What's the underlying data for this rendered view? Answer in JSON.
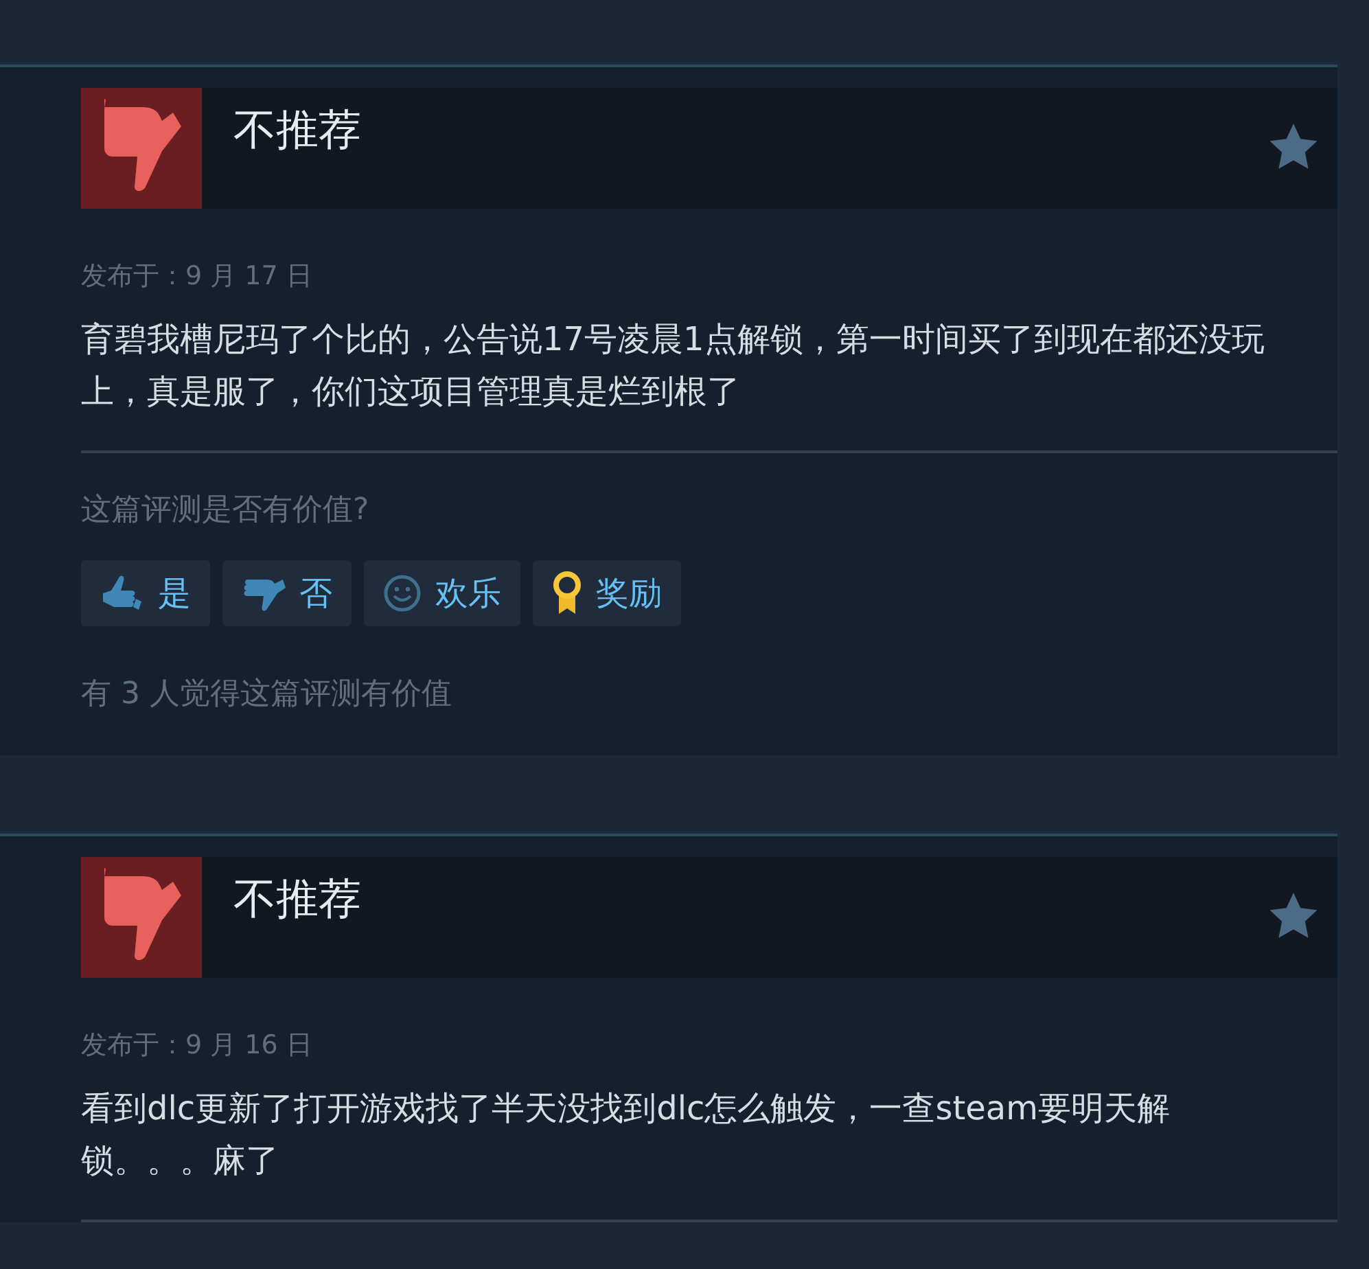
{
  "reviews": [
    {
      "verdict": "不推荐",
      "kind": "not_recommended",
      "posted": "发布于：9 月 17 日",
      "text": "育碧我槽尼玛了个比的，公告说17号凌晨1点解锁，第一时间买了到现在都还没玩上，真是服了，你们这项目管理真是烂到根了",
      "helpful_prompt": "这篇评测是否有价值?",
      "buttons": [
        {
          "kind": "yes",
          "label": "是"
        },
        {
          "kind": "no",
          "label": "否"
        },
        {
          "kind": "funny",
          "label": "欢乐"
        },
        {
          "kind": "award",
          "label": "奖励"
        }
      ],
      "helpful_count": "有 3 人觉得这篇评测有价值"
    },
    {
      "verdict": "不推荐",
      "kind": "not_recommended",
      "posted": "发布于：9 月 16 日",
      "text": "看到dlc更新了打开游戏找了半天没找到dlc怎么触发，一查steam要明天解锁。。。麻了"
    }
  ]
}
